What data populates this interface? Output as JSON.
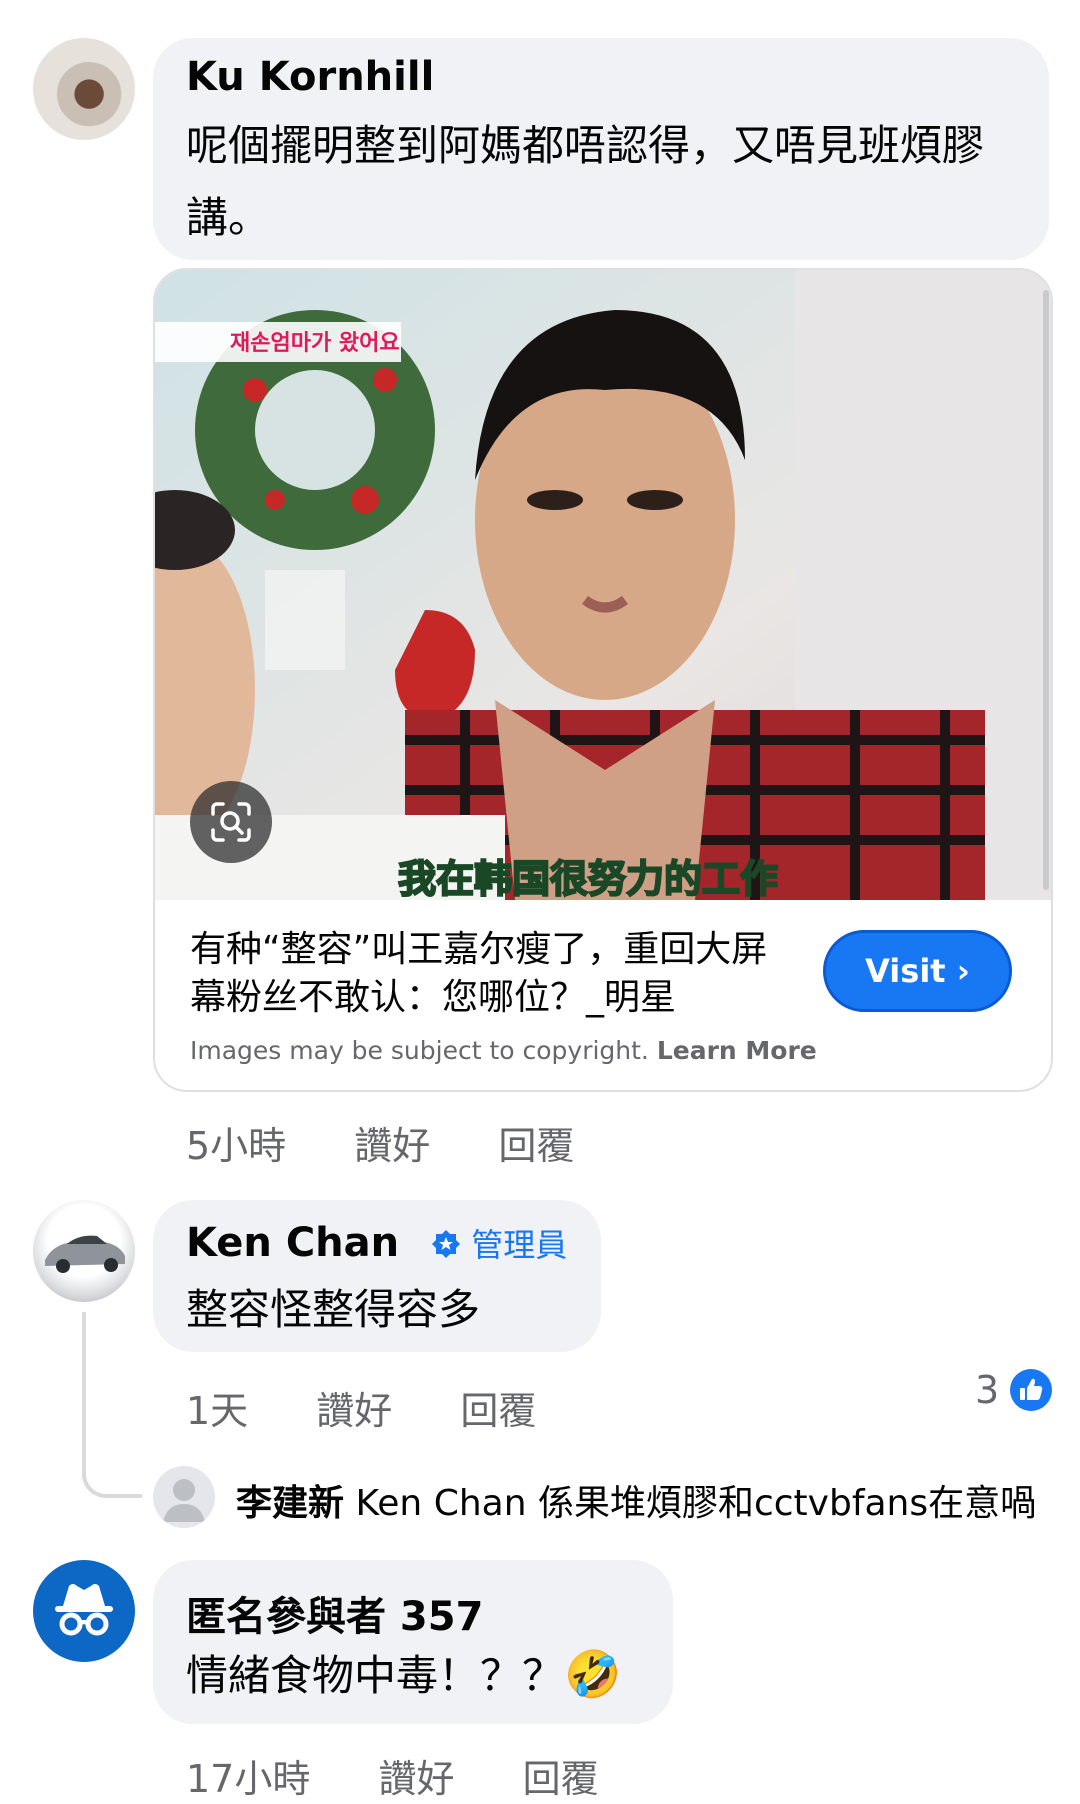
{
  "comment1": {
    "author": "Ku Kornhill",
    "text": "呢個擺明整到阿媽都唔認得，又唔見班煩膠講。",
    "link_preview": {
      "image_caption_overlay": "我在韩国很努力的工作",
      "image_tag_korean": "재손엄마가 왔어요",
      "headline": "有种“整容”叫王嘉尔瘦了，重回大屏幕粉丝不敢认：您哪位？_明星",
      "copyright_notice": "Images may be subject to copyright.",
      "learn_more": "Learn More",
      "visit_label": "Visit ›",
      "lens_icon": "visual-search-icon"
    },
    "time": "5小時",
    "like": "讚好",
    "reply": "回覆"
  },
  "comment2": {
    "author": "Ken Chan",
    "badge": "管理員",
    "text": "整容怪整得容多",
    "time": "1天",
    "like": "讚好",
    "reply": "回覆",
    "reaction_count": "3",
    "reaction_icon": "thumbs-up-icon",
    "reply_preview": {
      "author": "李建新",
      "text": "Ken Chan 係果堆煩膠和cctvbfans在意喎"
    }
  },
  "comment3": {
    "author": "匿名參與者 357",
    "text": "情緒食物中毒！？？",
    "emoji": "🤣",
    "time": "17小時",
    "like": "讚好",
    "reply": "回覆"
  },
  "colors": {
    "bubble": "#f0f2f5",
    "meta": "#65676b",
    "accent": "#1877f2",
    "anon_avatar": "#0c68c4"
  }
}
